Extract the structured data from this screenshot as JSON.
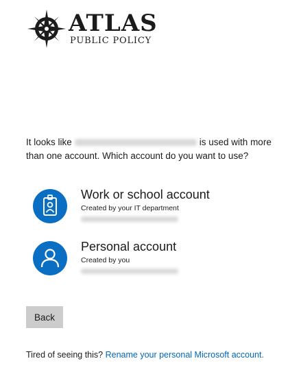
{
  "logo": {
    "title": "ATLAS",
    "subtitle": "PUBLIC POLICY",
    "icon": "compass-star-icon"
  },
  "question": {
    "prefix": "It looks like",
    "suffix": "is used with more than one account. Which account do you want to use?"
  },
  "accounts": [
    {
      "title": "Work or school account",
      "subtitle": "Created by your IT department",
      "icon": "id-badge-icon"
    },
    {
      "title": "Personal account",
      "subtitle": "Created by you",
      "icon": "person-icon"
    }
  ],
  "buttons": {
    "back": "Back"
  },
  "footer": {
    "text": "Tired of seeing this?",
    "link": "Rename your personal Microsoft account."
  },
  "colors": {
    "accent": "#0a6fc2",
    "link": "#0067b8",
    "button": "#cccccc"
  }
}
